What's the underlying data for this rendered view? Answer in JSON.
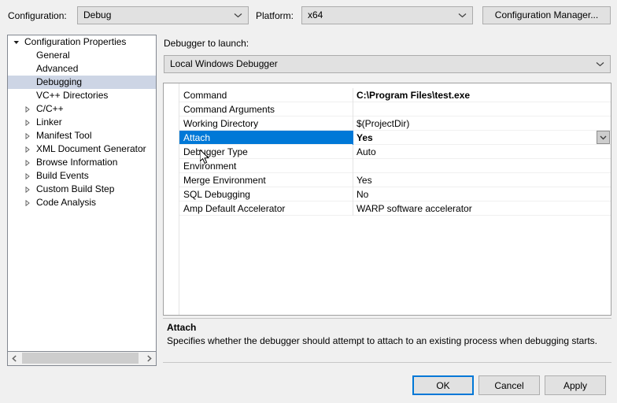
{
  "toolbar": {
    "configuration_label": "Configuration:",
    "configuration_value": "Debug",
    "platform_label": "Platform:",
    "platform_value": "x64",
    "config_manager_label": "Configuration Manager..."
  },
  "tree": {
    "items": [
      {
        "label": "Configuration Properties",
        "level": 0,
        "twisty": "expanded",
        "selected": false
      },
      {
        "label": "General",
        "level": 1,
        "twisty": "none",
        "selected": false
      },
      {
        "label": "Advanced",
        "level": 1,
        "twisty": "none",
        "selected": false
      },
      {
        "label": "Debugging",
        "level": 1,
        "twisty": "none",
        "selected": true
      },
      {
        "label": "VC++ Directories",
        "level": 1,
        "twisty": "none",
        "selected": false
      },
      {
        "label": "C/C++",
        "level": 1,
        "twisty": "collapsed",
        "selected": false
      },
      {
        "label": "Linker",
        "level": 1,
        "twisty": "collapsed",
        "selected": false
      },
      {
        "label": "Manifest Tool",
        "level": 1,
        "twisty": "collapsed",
        "selected": false
      },
      {
        "label": "XML Document Generator",
        "level": 1,
        "twisty": "collapsed",
        "selected": false
      },
      {
        "label": "Browse Information",
        "level": 1,
        "twisty": "collapsed",
        "selected": false
      },
      {
        "label": "Build Events",
        "level": 1,
        "twisty": "collapsed",
        "selected": false
      },
      {
        "label": "Custom Build Step",
        "level": 1,
        "twisty": "collapsed",
        "selected": false
      },
      {
        "label": "Code Analysis",
        "level": 1,
        "twisty": "collapsed",
        "selected": false
      }
    ]
  },
  "main": {
    "debugger_launch_label": "Debugger to launch:",
    "debugger_launch_value": "Local Windows Debugger",
    "properties": [
      {
        "name": "Command",
        "value": "C:\\Program Files\\test.exe",
        "bold": true,
        "selected": false,
        "editor": false
      },
      {
        "name": "Command Arguments",
        "value": "",
        "bold": false,
        "selected": false,
        "editor": false
      },
      {
        "name": "Working Directory",
        "value": "$(ProjectDir)",
        "bold": false,
        "selected": false,
        "editor": false
      },
      {
        "name": "Attach",
        "value": "Yes",
        "bold": true,
        "selected": true,
        "editor": true
      },
      {
        "name": "Debugger Type",
        "value": "Auto",
        "bold": false,
        "selected": false,
        "editor": false
      },
      {
        "name": "Environment",
        "value": "",
        "bold": false,
        "selected": false,
        "editor": false
      },
      {
        "name": "Merge Environment",
        "value": "Yes",
        "bold": false,
        "selected": false,
        "editor": false
      },
      {
        "name": "SQL Debugging",
        "value": "No",
        "bold": false,
        "selected": false,
        "editor": false
      },
      {
        "name": "Amp Default Accelerator",
        "value": "WARP software accelerator",
        "bold": false,
        "selected": false,
        "editor": false
      }
    ]
  },
  "description": {
    "title": "Attach",
    "body": "Specifies whether the debugger should attempt to attach to an existing process when debugging starts."
  },
  "buttons": {
    "ok": "OK",
    "cancel": "Cancel",
    "apply": "Apply"
  },
  "colors": {
    "selection_blue": "#0078d7",
    "tree_selection": "#cdd5e5",
    "dialog_bg": "#f0f0f0",
    "control_bg": "#e1e1e1"
  }
}
